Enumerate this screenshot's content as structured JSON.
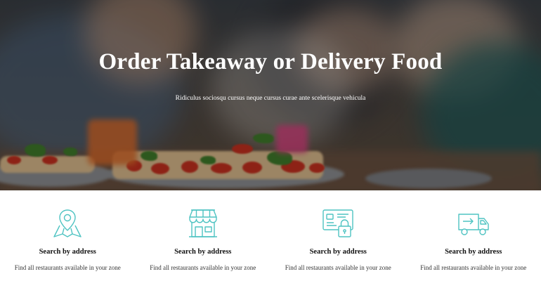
{
  "hero": {
    "title": "Order Takeaway or Delivery Food",
    "subtitle": "Ridiculus sociosqu cursus neque cursus curae ante scelerisque vehicula"
  },
  "colors": {
    "accent": "#4ec3c2"
  },
  "features": [
    {
      "icon": "map-pin-icon",
      "title": "Search by address",
      "description": "Find all restaurants available in your zone"
    },
    {
      "icon": "storefront-icon",
      "title": "Search by address",
      "description": "Find all restaurants available in your zone"
    },
    {
      "icon": "secure-card-icon",
      "title": "Search by address",
      "description": "Find all restaurants available in your zone"
    },
    {
      "icon": "delivery-truck-icon",
      "title": "Search by address",
      "description": "Find all restaurants available in your zone"
    }
  ]
}
